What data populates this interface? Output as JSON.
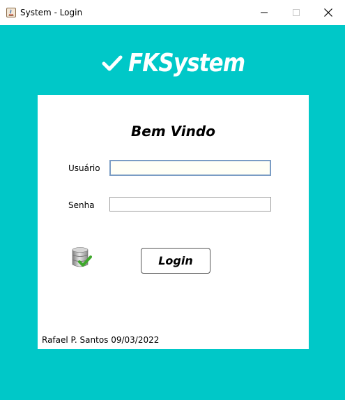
{
  "window": {
    "title": "System - Login",
    "controls": {
      "minimize": "minimize",
      "maximize": "maximize",
      "close": "close"
    }
  },
  "brand": {
    "name": "FKSystem",
    "icon": "checkmark-icon"
  },
  "form": {
    "heading": "Bem Vindo",
    "username_label": "Usuário",
    "username_value": "",
    "password_label": "Senha",
    "password_value": "",
    "login_button": "Login",
    "status_icon": "database-check-icon"
  },
  "footer": {
    "credit": "Rafael P. Santos 09/03/2022"
  },
  "colors": {
    "background": "#00c8c8",
    "card": "#ffffff",
    "brand_text": "#ffffff"
  }
}
